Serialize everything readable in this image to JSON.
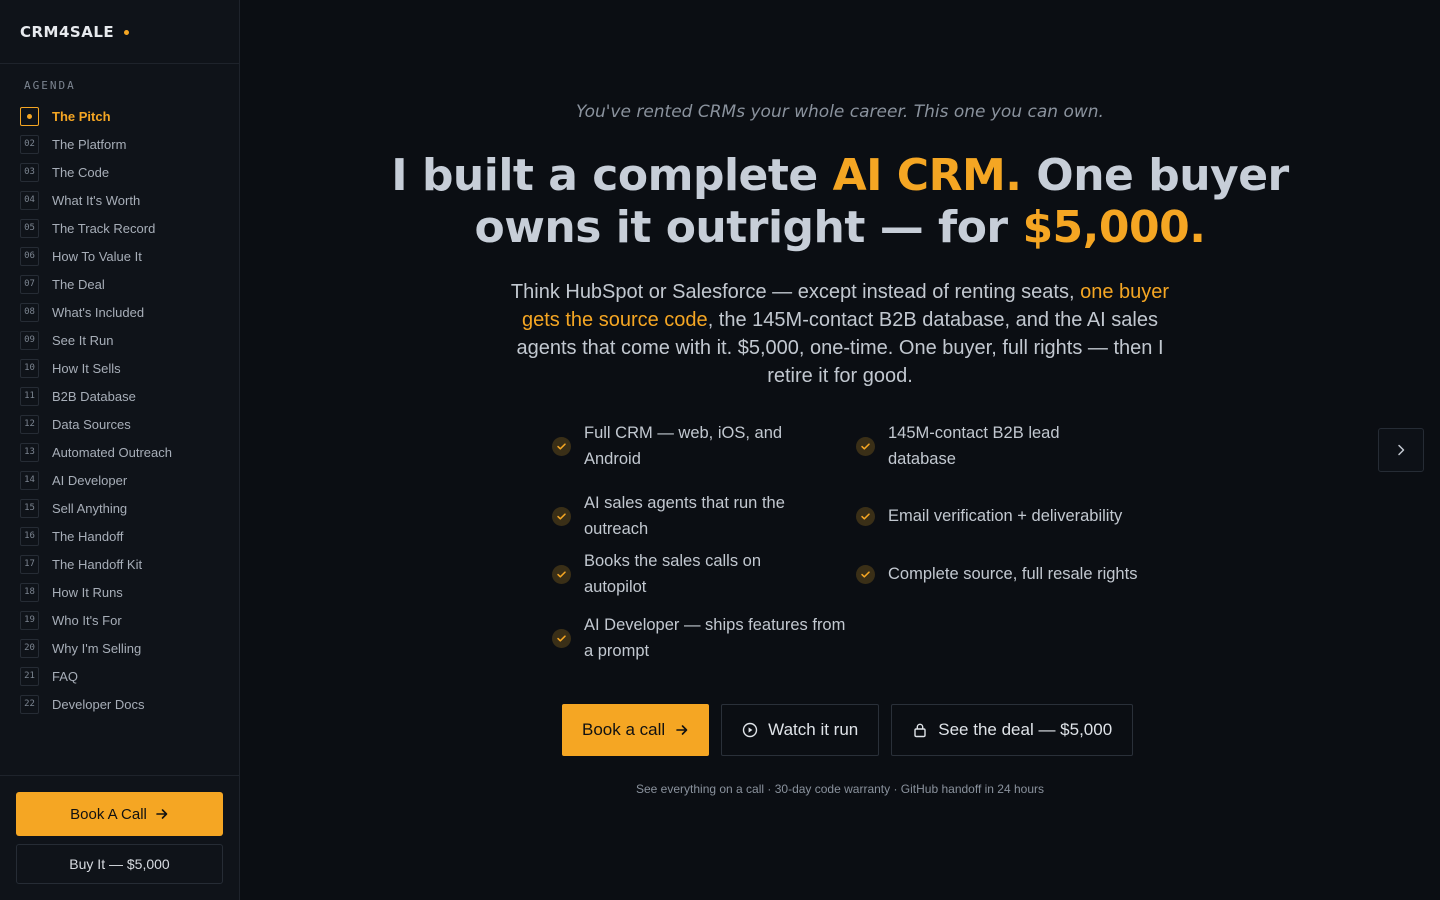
{
  "brand": {
    "name": "CRM4SALE"
  },
  "sidebar": {
    "agenda_title": "AGENDA",
    "items": [
      {
        "num": "",
        "label": "The Pitch",
        "active": true
      },
      {
        "num": "02",
        "label": "The Platform"
      },
      {
        "num": "03",
        "label": "The Code"
      },
      {
        "num": "04",
        "label": "What It's Worth"
      },
      {
        "num": "05",
        "label": "The Track Record"
      },
      {
        "num": "06",
        "label": "How To Value It"
      },
      {
        "num": "07",
        "label": "The Deal"
      },
      {
        "num": "08",
        "label": "What's Included"
      },
      {
        "num": "09",
        "label": "See It Run"
      },
      {
        "num": "10",
        "label": "How It Sells"
      },
      {
        "num": "11",
        "label": "B2B Database"
      },
      {
        "num": "12",
        "label": "Data Sources"
      },
      {
        "num": "13",
        "label": "Automated Outreach"
      },
      {
        "num": "14",
        "label": "AI Developer"
      },
      {
        "num": "15",
        "label": "Sell Anything"
      },
      {
        "num": "16",
        "label": "The Handoff"
      },
      {
        "num": "17",
        "label": "The Handoff Kit"
      },
      {
        "num": "18",
        "label": "How It Runs"
      },
      {
        "num": "19",
        "label": "Who It's For"
      },
      {
        "num": "20",
        "label": "Why I'm Selling"
      },
      {
        "num": "21",
        "label": "FAQ"
      },
      {
        "num": "22",
        "label": "Developer Docs"
      }
    ],
    "cta_label": "Book A Call",
    "buy_label": "Buy It — $5,000"
  },
  "hero": {
    "tagline": "You've rented CRMs your whole career. This one you can own.",
    "headline_1": "I built a complete ",
    "headline_accent_1": "AI CRM.",
    "headline_2": " One buyer owns it outright — for ",
    "headline_accent_2": "$5,000.",
    "sub_1": "Think HubSpot or Salesforce — except instead of renting seats, ",
    "sub_accent": "one buyer gets the source code",
    "sub_2": ", the 145M-contact B2B database, and the AI sales agents that come with it. $5,000, one-time. One buyer, full rights — then I retire it for good."
  },
  "features": [
    "Full CRM — web, iOS, and Android",
    "145M-contact B2B lead database",
    "AI sales agents that run the outreach",
    "Email verification + deliverability",
    "Books the sales calls on autopilot",
    "Complete source, full resale rights",
    "AI Developer — ships features from a prompt"
  ],
  "cta": {
    "primary": "Book a call",
    "watch": "Watch it run",
    "deal": "See the deal — $5,000"
  },
  "footnote": "See everything on a call · 30-day code warranty · GitHub handoff in 24 hours",
  "colors": {
    "accent": "#f5a623",
    "background": "#0b0e13",
    "sidebar": "#0f1319"
  }
}
